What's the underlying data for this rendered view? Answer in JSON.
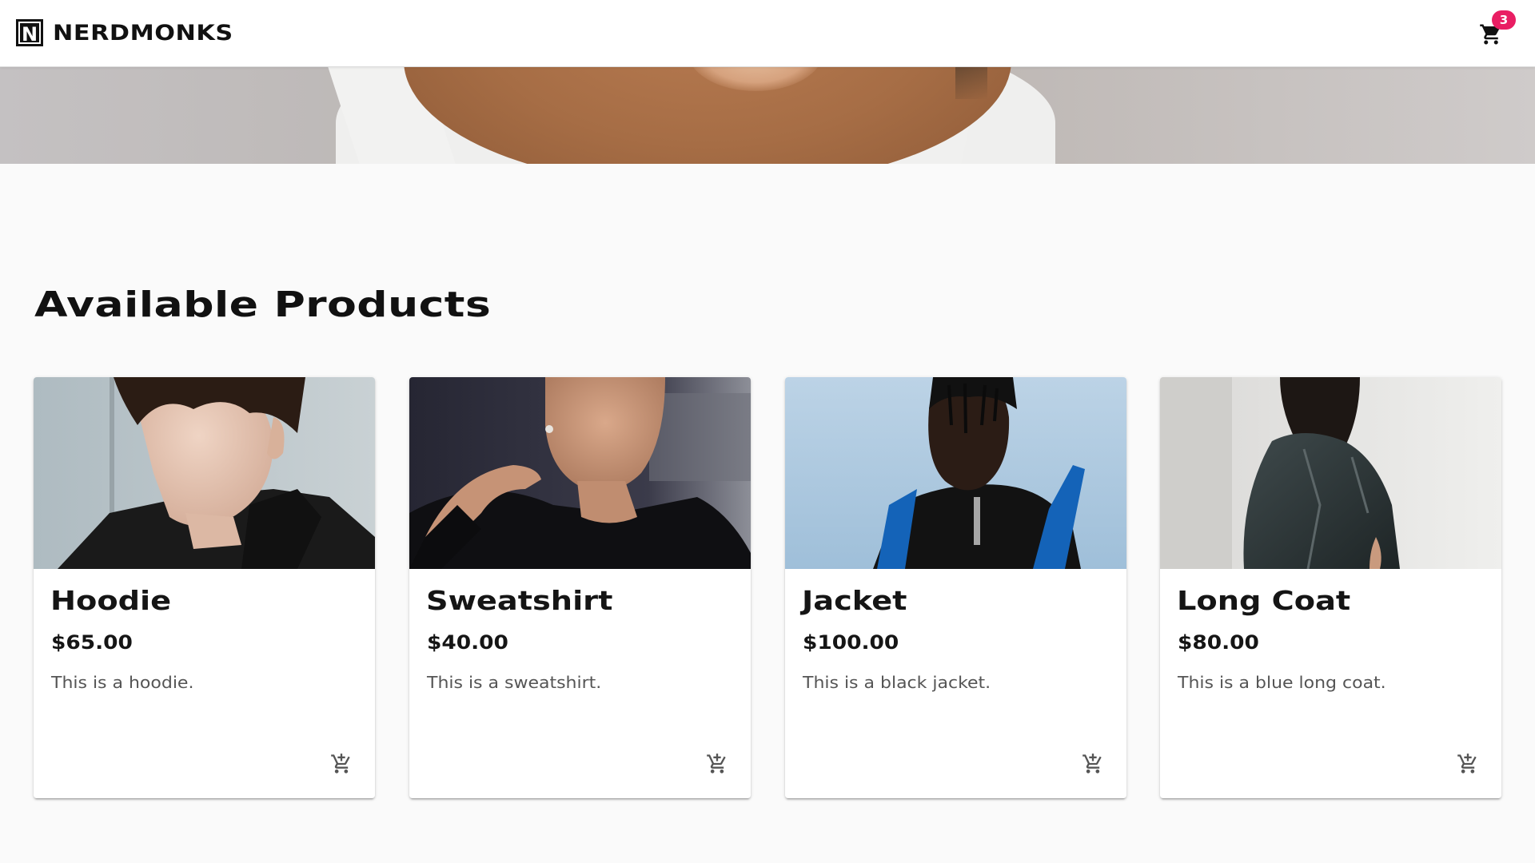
{
  "header": {
    "logo_letter": "N",
    "brand_name": "NERDMONKS",
    "cart_icon": "shopping-cart-icon",
    "cart_count": "3",
    "badge_color": "#e91e63"
  },
  "hero": {
    "image": "hero-banner-image"
  },
  "main": {
    "section_title": "Available Products",
    "products": [
      {
        "name": "Hoodie",
        "price": "$65.00",
        "description": "This is a hoodie.",
        "image": "hoodie-product-image",
        "action_icon": "add-to-cart-icon"
      },
      {
        "name": "Sweatshirt",
        "price": "$40.00",
        "description": "This is a sweatshirt.",
        "image": "sweatshirt-product-image",
        "action_icon": "add-to-cart-icon"
      },
      {
        "name": "Jacket",
        "price": "$100.00",
        "description": "This is a black jacket.",
        "image": "jacket-product-image",
        "action_icon": "add-to-cart-icon"
      },
      {
        "name": "Long Coat",
        "price": "$80.00",
        "description": "This is a blue long coat.",
        "image": "long-coat-product-image",
        "action_icon": "add-to-cart-icon"
      }
    ]
  }
}
